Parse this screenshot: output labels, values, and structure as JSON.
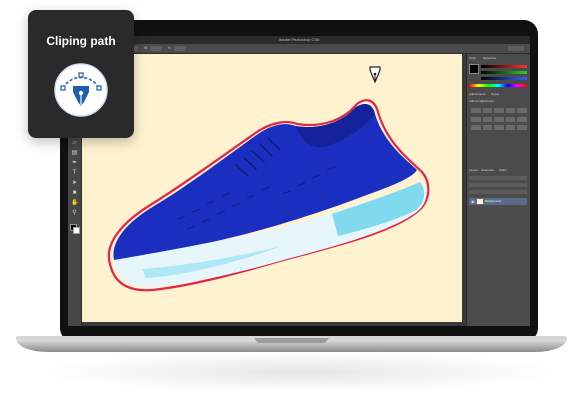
{
  "card": {
    "title": "Cliping path",
    "icon": "pen-tool-icon"
  },
  "app": {
    "title": "Adobe Photoshop CS6"
  },
  "options_bar": {
    "labels": [
      "Fill",
      "Stroke",
      "W",
      "H"
    ]
  },
  "panels": {
    "tabs_top": [
      "Color",
      "Swatches"
    ],
    "tabs_mid": [
      "Adjustments",
      "Styles"
    ],
    "adjustments_label": "Add an adjustment",
    "tabs_bottom": [
      "Layers",
      "Channels",
      "Paths"
    ],
    "layer_name": "Background"
  },
  "colors": {
    "canvas": "#fff2cf",
    "shoe_upper": "#1a2fc0",
    "shoe_sole": "#7fd9ef",
    "clip_path": "#e0264a",
    "card_bg": "#2a2a2a",
    "icon_blue": "#1f5fae"
  }
}
